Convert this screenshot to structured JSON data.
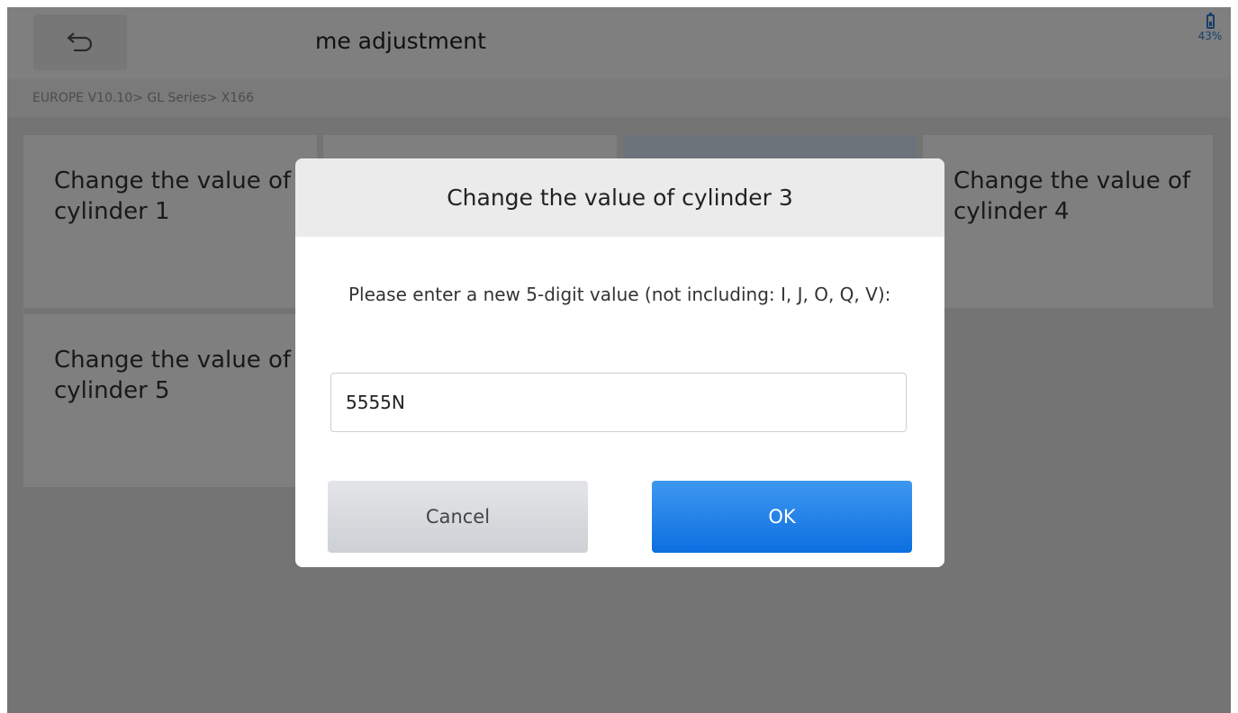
{
  "header": {
    "back_icon": "back-arrow-icon",
    "title": "me adjustment",
    "battery_icon": "battery-icon",
    "battery_percent": "43%"
  },
  "breadcrumb": "EUROPE V10.10> GL Series> X166",
  "tiles": [
    {
      "label": "Change the value of cylinder 1"
    },
    {
      "label": ""
    },
    {
      "label": ""
    },
    {
      "label": "Change the value of cylinder 4"
    },
    {
      "label": "Change the value of cylinder 5"
    }
  ],
  "dialog": {
    "title": "Change the value of cylinder 3",
    "message": "Please enter a new 5-digit value (not including: I, J, O, Q, V):",
    "input_value": "5555N",
    "cancel_label": "Cancel",
    "ok_label": "OK"
  },
  "colors": {
    "accent": "#1a7ee8",
    "battery": "#2f7fd6"
  }
}
